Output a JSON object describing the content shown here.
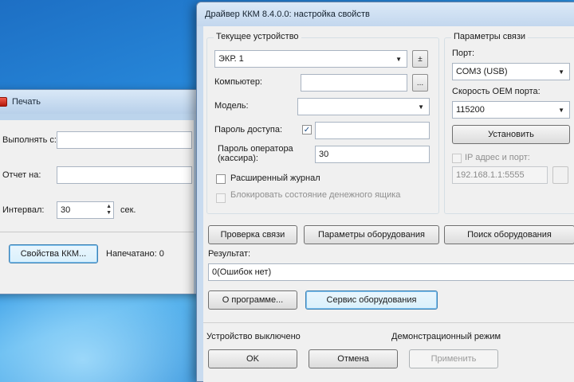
{
  "back_window": {
    "title": "Печать",
    "print_from_label": "Выполнять с:",
    "report_label": "Отчет на:",
    "interval_label": "Интервал:",
    "interval_value": "30",
    "interval_unit": "сек.",
    "kkm_props_button": "Свойства ККМ...",
    "printing_status": "Напечатано: 0"
  },
  "front_window": {
    "title": "Драйвер ККМ 8.4.0.0: настройка свойств",
    "current_device_group": "Текущее устройство",
    "device_select": "ЭКР. 1",
    "computer_label": "Компьютер:",
    "computer_value": "",
    "computer_browse": "...",
    "model_label": "Модель:",
    "model_value": "",
    "access_password_label": "Пароль доступа:",
    "operator_password_label": "Пароль оператора (кассира):",
    "operator_password_value": "30",
    "extended_log_label": "Расширенный журнал",
    "block_device_label": "Блокировать состояние денежного ящика",
    "link_params_group": "Параметры связи",
    "port_label": "Порт:",
    "port_value": "СОМ3 (USB)",
    "speed_label": "Скорость ОЕМ порта:",
    "speed_value": "115200",
    "setup_button": "Установить",
    "ip_label": "IP адрес и порт:",
    "ip_value": "192.168.1.1:5555",
    "check_link_button": "Проверка связи",
    "equipment_params_button": "Параметры оборудования",
    "search_equipment_button": "Поиск оборудования",
    "result_label": "Результат:",
    "result_value": "0(Ошибок нет)",
    "about_button": "О программе...",
    "service_button": "Сервис оборудования",
    "device_enabled_label": "Устройство выключено",
    "demo_mode_label": "Демонстрационный режим",
    "ok_button": "OK",
    "cancel_button": "Отмена",
    "apply_button": "Применить"
  }
}
